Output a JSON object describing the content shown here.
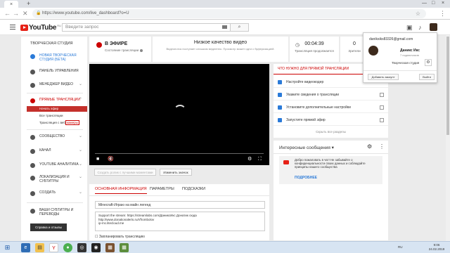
{
  "browser": {
    "tab_glyph": "×",
    "newtab_glyph": "+",
    "url": "https://www.youtube.com/live_dashboard?o=U",
    "window_controls": [
      "—",
      "□",
      "×"
    ]
  },
  "header": {
    "logo_text": "YouTube",
    "logo_region": "RU",
    "search_placeholder": "Введите запрос"
  },
  "sidebar": {
    "title": "ТВОРЧЕСКАЯ СТУДИЯ",
    "items": [
      {
        "label": "Новая творческая студия (бета)"
      },
      {
        "label": "Панель управления"
      },
      {
        "label": "Менеджер видео"
      },
      {
        "label": "Прямые трансляции"
      },
      {
        "label": "Сообщество"
      },
      {
        "label": "Канал"
      },
      {
        "label": "YouTube Аналитика"
      },
      {
        "label": "Локализация и субтитры"
      },
      {
        "label": "Создать"
      },
      {
        "label": "Ваши субтитры и переводы"
      }
    ],
    "subitems": [
      "Начать эфир",
      "Все трансляции",
      "Трансляция с веб"
    ],
    "sub_highlight": "камеры",
    "feedback": "Справка и отзывы"
  },
  "status": {
    "live_title": "В ЭФИРЕ",
    "live_sub": "Состояние трансляции",
    "quality_title": "Низкое качество видео",
    "quality_desc": "Видеопоток поступает слишком медленно. Просмотр может идти с буферизацией.",
    "duration": "00:04:39",
    "duration_sub": "Трансляция продолжается",
    "viewers": "0",
    "viewers_sub": "Зрители"
  },
  "player": {
    "create_clip": "Создать ролик с лучшими моментами",
    "change_thumb": "Изменить значок"
  },
  "info": {
    "tabs": [
      "Основная информация",
      "Параметры",
      "Подсказки"
    ],
    "title_value": "Minecraft-Играю на майн легенд",
    "description": "Support the stream: https://streamlabs.com/ДаниксИкс Донатик сюда\nhttp://www.donationalerts.ru/r/frombolov\nip-mc.litecloud.me",
    "scheduled": "Запланировать трансляцию"
  },
  "checklist": {
    "header": "Что нужно для прямой трансляции",
    "items": [
      "Настройте видеокодер",
      "Укажите сведения о трансляции",
      "Установите дополнительные настройки",
      "Запустите прямой эфир"
    ],
    "hide": "Скрыть все разделы"
  },
  "chat": {
    "title": "Интересные сообщения",
    "welcome": "Добро пожаловать в чат! Не забывайте о конфиденциальности своих данных и соблюдайте принципы нашего сообщества",
    "more": "ПОДРОБНЕЕ"
  },
  "account": {
    "email": "daniksiks83326@gmail.com",
    "name": "Даникс Икс",
    "subs": "7 подписчиков",
    "studio": "Творческая студия",
    "add": "Добавить аккаунт",
    "logout": "Выйти"
  },
  "taskbar": {
    "lang": "RU",
    "time": "9:06",
    "date": "24.02.2019"
  },
  "colors": {
    "accent_red": "#c00000",
    "link_blue": "#2a7ad8"
  }
}
